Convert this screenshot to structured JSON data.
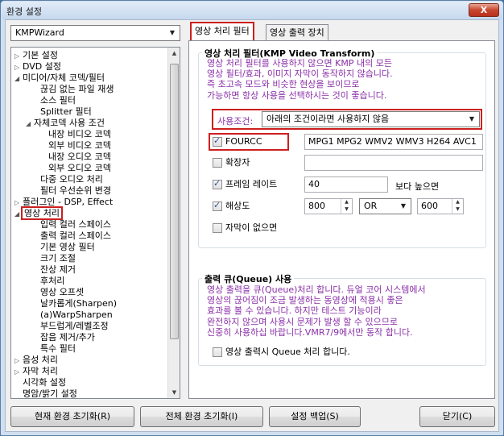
{
  "window": {
    "title": "환경 설정",
    "close_label": "X"
  },
  "left": {
    "combo_value": "KMPWizard",
    "tree": [
      {
        "label": "기본 설정",
        "exp": "▷"
      },
      {
        "label": "DVD 설정",
        "exp": "▷"
      },
      {
        "label": "미디어/자체 코덱/필터",
        "exp": "◢"
      },
      {
        "label": "끊김 없는 파일 재생",
        "exp": ""
      },
      {
        "label": "소스 필터",
        "exp": ""
      },
      {
        "label": "Splitter 필터",
        "exp": ""
      },
      {
        "label": "자체코덱 사용 조건",
        "exp": "◢"
      },
      {
        "label": "내장 비디오 코덱",
        "exp": ""
      },
      {
        "label": "외부 비디오 코덱",
        "exp": ""
      },
      {
        "label": "내장 오디오 코덱",
        "exp": ""
      },
      {
        "label": "외부 오디오 코덱",
        "exp": ""
      },
      {
        "label": "다중 오디오 처리",
        "exp": ""
      },
      {
        "label": "필터 우선순위 변경",
        "exp": ""
      },
      {
        "label": "플러그인 - DSP, Effect",
        "exp": "▷"
      },
      {
        "label": "영상 처리",
        "exp": "◢"
      },
      {
        "label": "입력 컬러 스페이스",
        "exp": ""
      },
      {
        "label": "출력 컬러 스페이스",
        "exp": ""
      },
      {
        "label": "기본 영상 필터",
        "exp": ""
      },
      {
        "label": "크기 조절",
        "exp": ""
      },
      {
        "label": "잔상 제거",
        "exp": ""
      },
      {
        "label": "후처리",
        "exp": ""
      },
      {
        "label": "영상 오프셋",
        "exp": ""
      },
      {
        "label": "날카롭게(Sharpen)",
        "exp": ""
      },
      {
        "label": "(a)WarpSharpen",
        "exp": ""
      },
      {
        "label": "부드럽게/레벨조정",
        "exp": ""
      },
      {
        "label": "잡음 제거/추가",
        "exp": ""
      },
      {
        "label": "특수 필터",
        "exp": ""
      },
      {
        "label": "음성 처리",
        "exp": "▷"
      },
      {
        "label": "자막 처리",
        "exp": "▷"
      },
      {
        "label": "시각화 설정",
        "exp": ""
      },
      {
        "label": "명암/밝기 설정",
        "exp": ""
      }
    ]
  },
  "tabs": {
    "video_filter": "영상 처리 필터",
    "video_output": "영상 출력 장치"
  },
  "filter_group": {
    "title": "영상 처리 필터(KMP Video Transform)",
    "description": "영상 처리 필터를 사용하지 않으면 KMP 내의 모든\n영상 필터/효과, 이미지 자막이 동작하지 않습니다.\n즉 초고속 모드와 비슷한 현상을 보이므로\n가능하면 항상 사용을 선택하시는 것이 좋습니다.",
    "condition_label": "사용조건:",
    "condition_value": "아래의 조건이라면 사용하지 않음",
    "fourcc": {
      "label": "FOURCC",
      "checked": true,
      "value": "MPG1 MPG2 WMV2 WMV3 H264 AVC1"
    },
    "extension": {
      "label": "확장자",
      "checked": false,
      "value": ""
    },
    "framerate": {
      "label": "프레임 레이트",
      "checked": true,
      "value": "40",
      "suffix": "보다 높으면"
    },
    "resolution": {
      "label": "해상도",
      "checked": true,
      "width": "800",
      "op": "OR",
      "height": "600"
    },
    "no_subtitle": {
      "label": "자막이 없으면",
      "checked": false
    }
  },
  "queue_group": {
    "title": "출력 큐(Queue) 사용",
    "description": "영상 출력을 큐(Queue)처리 합니다. 듀얼 코어 시스템에서\n영상의 끊어짐이 조금 발생하는 동영상에 적용시 좋은\n효과를 볼 수 있습니다. 하지만 테스트 기능이라\n완전하지 않으며 사용시 문제가 발생 할 수 있으므로\n신중히 사용하십 바랍니다.VMR7/9에서만 동작 합니다.",
    "checkbox_label": "영상 출력시 Queue 처리 합니다.",
    "checked": false
  },
  "buttons": {
    "reset_current": "현재 환경 초기화(R)",
    "reset_all": "전체 환경 초기화(I)",
    "backup": "설정 백업(S)",
    "close": "닫기(C)"
  }
}
